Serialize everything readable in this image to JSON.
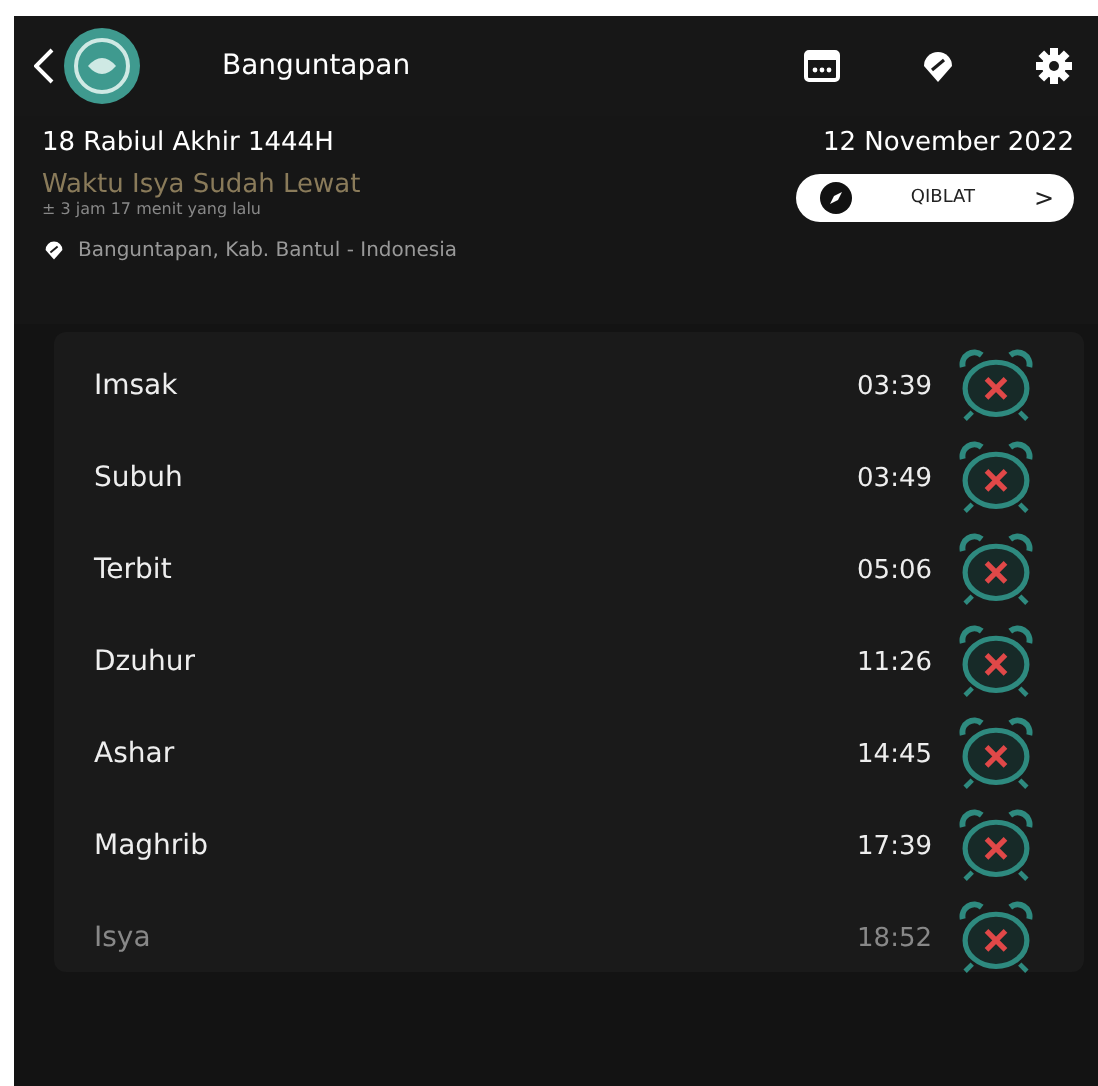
{
  "header": {
    "title": "Banguntapan"
  },
  "hijri_date": "18 Rabiul Akhir 1444H",
  "gregorian_date": "12 November 2022",
  "status": {
    "title": "Waktu Isya Sudah Lewat",
    "subtitle": "± 3 jam 17 menit yang lalu"
  },
  "qiblat_button": {
    "label": "QIBLAT",
    "arrow": ">"
  },
  "location": "Banguntapan, Kab. Bantul - Indonesia",
  "prayers": [
    {
      "name": "Imsak",
      "time": "03:39",
      "current": false,
      "alarm_on": false
    },
    {
      "name": "Subuh",
      "time": "03:49",
      "current": false,
      "alarm_on": false
    },
    {
      "name": "Terbit",
      "time": "05:06",
      "current": false,
      "alarm_on": false
    },
    {
      "name": "Dzuhur",
      "time": "11:26",
      "current": false,
      "alarm_on": false
    },
    {
      "name": "Ashar",
      "time": "14:45",
      "current": false,
      "alarm_on": false
    },
    {
      "name": "Maghrib",
      "time": "17:39",
      "current": false,
      "alarm_on": false
    },
    {
      "name": "Isya",
      "time": "18:52",
      "current": true,
      "alarm_on": false
    }
  ]
}
